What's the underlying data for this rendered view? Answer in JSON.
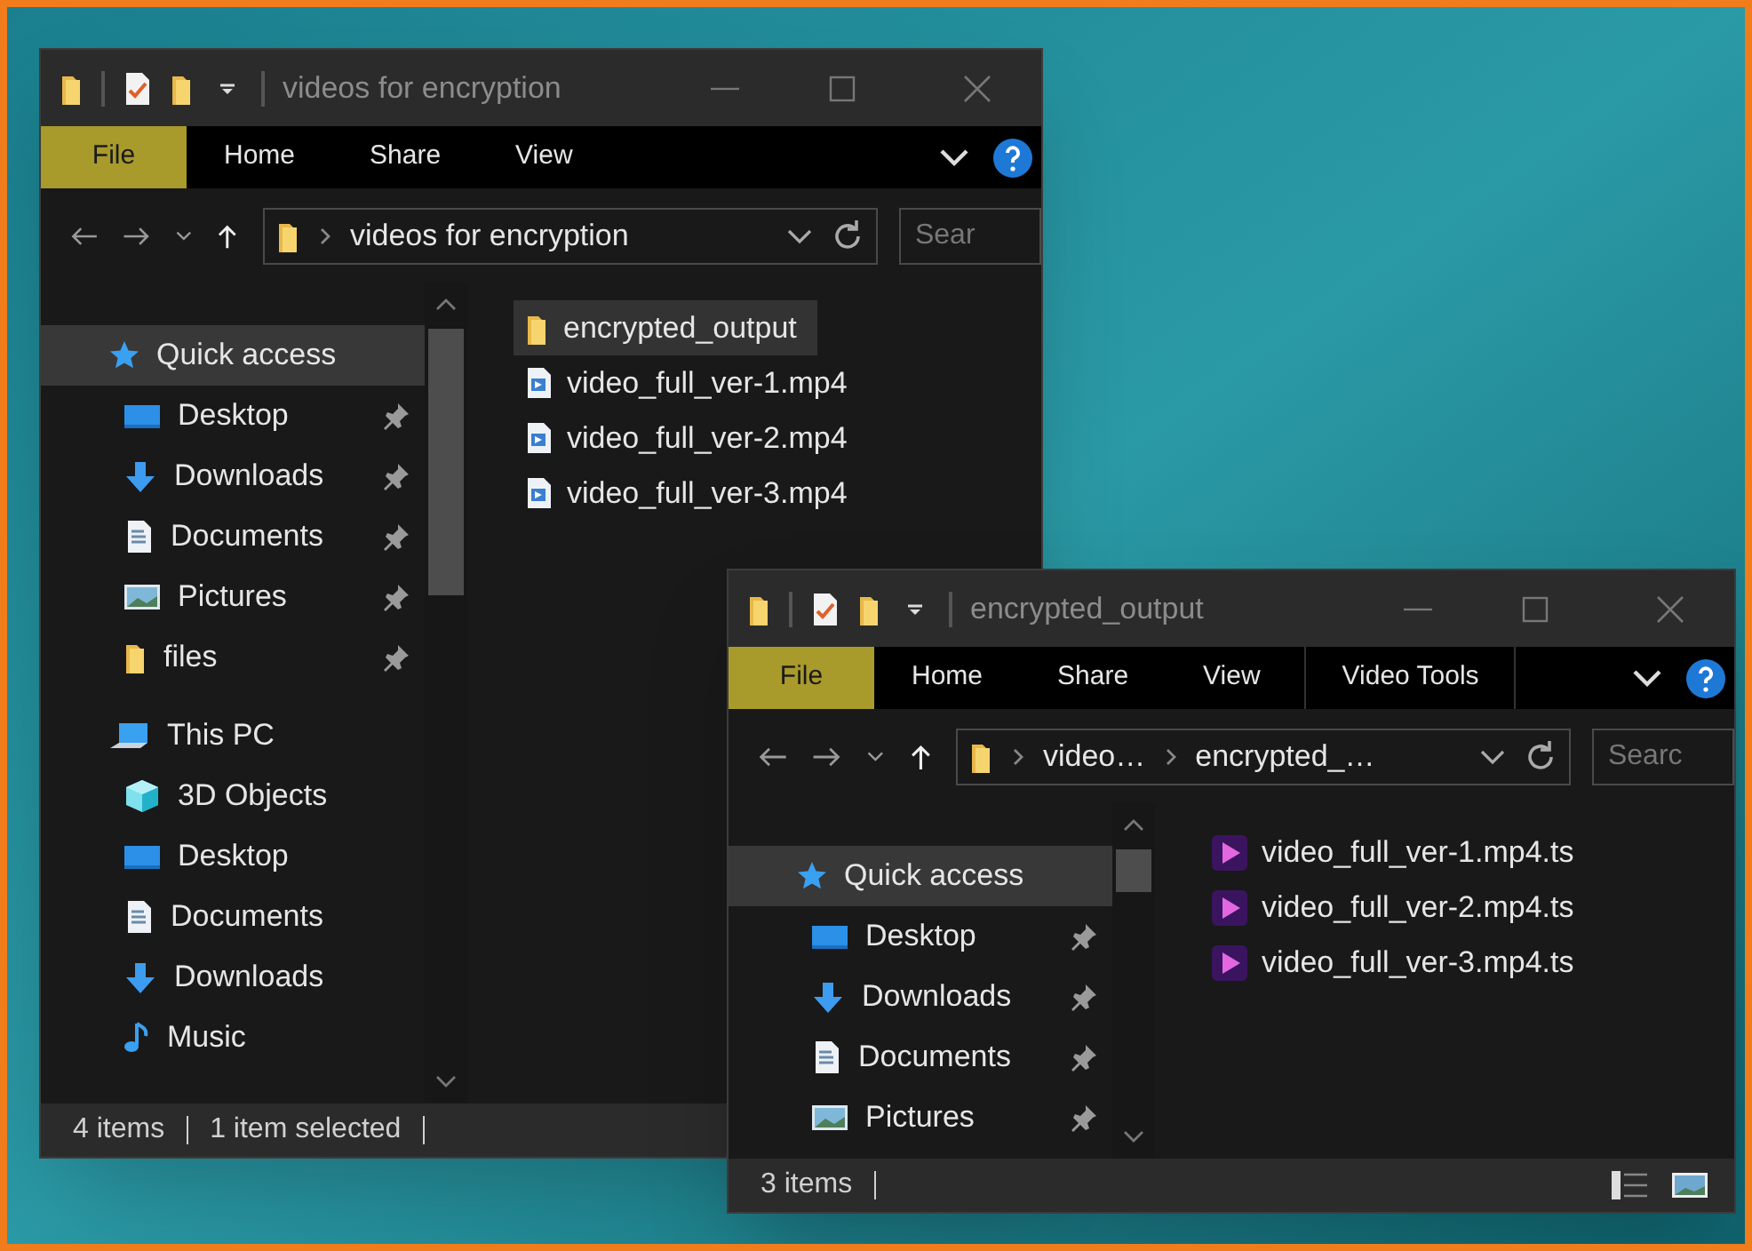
{
  "windows": [
    {
      "title": "videos for encryption",
      "tabs": [
        {
          "label": "File",
          "kind": "file"
        },
        {
          "label": "Home",
          "kind": "tab"
        },
        {
          "label": "Share",
          "kind": "tab"
        },
        {
          "label": "View",
          "kind": "tab"
        }
      ],
      "address": [
        "videos for encryption"
      ],
      "search": {
        "placeholder": "Sear"
      },
      "nav": [
        {
          "label": "Quick access",
          "kind": "star",
          "header": true,
          "pinned": false,
          "selected": true
        },
        {
          "label": "Desktop",
          "kind": "desktop",
          "header": false,
          "pinned": true,
          "selected": false
        },
        {
          "label": "Downloads",
          "kind": "download",
          "header": false,
          "pinned": true,
          "selected": false
        },
        {
          "label": "Documents",
          "kind": "document",
          "header": false,
          "pinned": true,
          "selected": false
        },
        {
          "label": "Pictures",
          "kind": "picture",
          "header": false,
          "pinned": true,
          "selected": false
        },
        {
          "label": "files",
          "kind": "folder",
          "header": false,
          "pinned": true,
          "selected": false
        },
        {
          "label": "This PC",
          "kind": "pc",
          "header": true,
          "pinned": false,
          "selected": false
        },
        {
          "label": "3D Objects",
          "kind": "cube",
          "header": false,
          "pinned": false,
          "selected": false
        },
        {
          "label": "Desktop",
          "kind": "desktop",
          "header": false,
          "pinned": false,
          "selected": false
        },
        {
          "label": "Documents",
          "kind": "document",
          "header": false,
          "pinned": false,
          "selected": false
        },
        {
          "label": "Downloads",
          "kind": "download",
          "header": false,
          "pinned": false,
          "selected": false
        },
        {
          "label": "Music",
          "kind": "music",
          "header": false,
          "pinned": false,
          "selected": false
        }
      ],
      "files": [
        {
          "name": "encrypted_output",
          "kind": "folder",
          "selected": true
        },
        {
          "name": "video_full_ver-1.mp4",
          "kind": "mp4",
          "selected": false
        },
        {
          "name": "video_full_ver-2.mp4",
          "kind": "mp4",
          "selected": false
        },
        {
          "name": "video_full_ver-3.mp4",
          "kind": "mp4",
          "selected": false
        }
      ],
      "status": [
        "4 items",
        "1 item selected"
      ]
    },
    {
      "title": "encrypted_output",
      "tabs": [
        {
          "label": "File",
          "kind": "file"
        },
        {
          "label": "Home",
          "kind": "tab"
        },
        {
          "label": "Share",
          "kind": "tab"
        },
        {
          "label": "View",
          "kind": "tab"
        },
        {
          "label": "Video Tools",
          "kind": "context"
        }
      ],
      "address": [
        "video…",
        "encrypted_…"
      ],
      "search": {
        "placeholder": "Searc"
      },
      "nav": [
        {
          "label": "Quick access",
          "kind": "star",
          "header": true,
          "pinned": false,
          "selected": true
        },
        {
          "label": "Desktop",
          "kind": "desktop",
          "header": false,
          "pinned": true,
          "selected": false
        },
        {
          "label": "Downloads",
          "kind": "download",
          "header": false,
          "pinned": true,
          "selected": false
        },
        {
          "label": "Documents",
          "kind": "document",
          "header": false,
          "pinned": true,
          "selected": false
        },
        {
          "label": "Pictures",
          "kind": "picture",
          "header": false,
          "pinned": true,
          "selected": false
        }
      ],
      "files": [
        {
          "name": "video_full_ver-1.mp4.ts",
          "kind": "video",
          "selected": false
        },
        {
          "name": "video_full_ver-2.mp4.ts",
          "kind": "video",
          "selected": false
        },
        {
          "name": "video_full_ver-3.mp4.ts",
          "kind": "video",
          "selected": false
        }
      ],
      "status": [
        "3 items"
      ]
    }
  ]
}
